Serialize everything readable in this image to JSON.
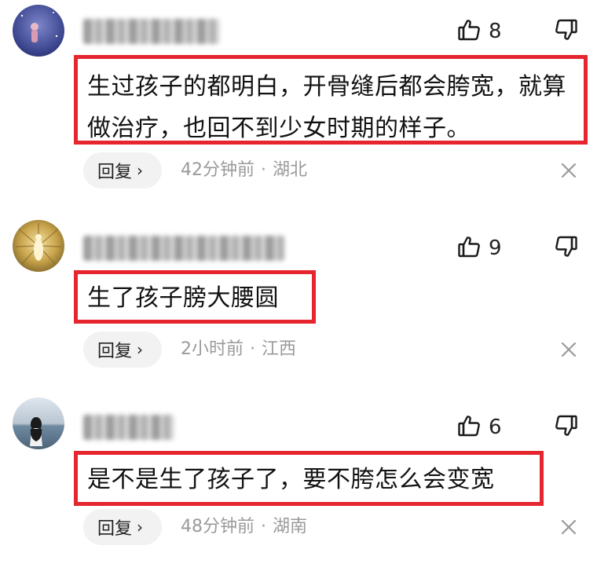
{
  "comments": [
    {
      "likes": "8",
      "text": "生过孩子的都明白，开骨缝后都会胯宽，就算做治疗，也回不到少女时期的样子。",
      "reply_label": "回复",
      "reply_chevron": "›",
      "time": "42分钟前",
      "separator": "·",
      "location": "湖北",
      "highlight_color": "#e5262f"
    },
    {
      "likes": "9",
      "text": "生了孩子膀大腰圆",
      "reply_label": "回复",
      "reply_chevron": "›",
      "time": "2小时前",
      "separator": "·",
      "location": "江西",
      "highlight_color": "#e5262f"
    },
    {
      "likes": "6",
      "text": "是不是生了孩子了，要不胯怎么会变宽",
      "reply_label": "回复",
      "reply_chevron": "›",
      "time": "48分钟前",
      "separator": "·",
      "location": "湖南",
      "highlight_color": "#e5262f"
    }
  ],
  "icons": {
    "like": "thumbs-up-outline",
    "dislike": "thumbs-down-outline",
    "close": "close-x",
    "username": "blurred-username"
  }
}
